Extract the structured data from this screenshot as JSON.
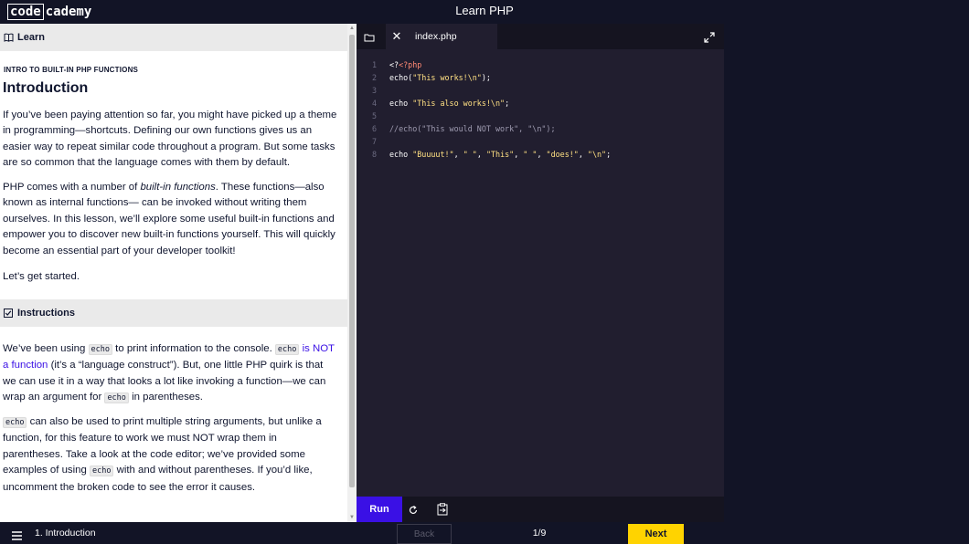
{
  "header": {
    "logo_part1": "code",
    "logo_part2": "cademy",
    "title": "Learn PHP"
  },
  "learn": {
    "section_label": "Learn",
    "kicker": "INTRO TO BUILT-IN PHP FUNCTIONS",
    "title": "Introduction",
    "p1": "If you’ve been paying attention so far, you might have picked up a theme in programming—shortcuts. Defining our own functions gives us an easier way to repeat similar code throughout a program. But some tasks are so common that the language comes with them by default.",
    "p2_a": "PHP comes with a number of ",
    "p2_em": "built-in functions",
    "p2_b": ". These functions—also known as internal functions— can be invoked without writing them ourselves. In this lesson, we’ll explore some useful built-in functions and empower you to discover new built-in functions yourself. This will quickly become an essential part of your developer toolkit!",
    "p3": "Let’s get started."
  },
  "instructions": {
    "section_label": "Instructions",
    "i1_a": "We’ve been using ",
    "i1_code1": "echo",
    "i1_b": " to print information to the console. ",
    "i1_code2": "echo",
    "i1_link": " is NOT a function",
    "i1_c": " (it’s a “language construct”). But, one little PHP quirk is that we can use it in a way that looks a lot like invoking a function—we can wrap an argument for ",
    "i1_code3": "echo",
    "i1_d": " in parentheses.",
    "i2_code1": "echo",
    "i2_a": " can also be used to print multiple string arguments, but unlike a function, for this feature to work we must NOT wrap them in parentheses. Take a look at the code editor; we’ve provided some examples of using ",
    "i2_code2": "echo",
    "i2_b": " with and without parentheses. If you’d like, uncomment the broken code to see the error it causes."
  },
  "editor": {
    "tab_name": "index.php",
    "line_numbers": [
      "1",
      "2",
      "3",
      "4",
      "5",
      "6",
      "7",
      "8"
    ],
    "lines": {
      "l1_tag": "<?php",
      "l2_kw": "echo(",
      "l2_str": "\"This works!\\n\"",
      "l2_end": ");",
      "l4_kw": "echo ",
      "l4_str": "\"This also works!\\n\"",
      "l4_end": ";",
      "l6_com": "//echo(\"This would NOT work\", \"\\n\");",
      "l8_kw": "echo ",
      "l8_s1": "\"Buuuut!\"",
      "l8_c1": ", ",
      "l8_s2": "\" \"",
      "l8_c2": ", ",
      "l8_s3": "\"This\"",
      "l8_c3": ", ",
      "l8_s4": "\" \"",
      "l8_c4": ", ",
      "l8_s5": "\"does!\"",
      "l8_c5": ", ",
      "l8_s6": "\"\\n\"",
      "l8_end": ";"
    },
    "run_label": "Run"
  },
  "footer": {
    "lesson_label": "1. Introduction",
    "back_label": "Back",
    "progress": "1/9",
    "next_label": "Next"
  },
  "colors": {
    "accent": "#3a10e5",
    "next_button": "#ffd300",
    "chrome": "#121426",
    "editor_bg": "#211e2f"
  }
}
